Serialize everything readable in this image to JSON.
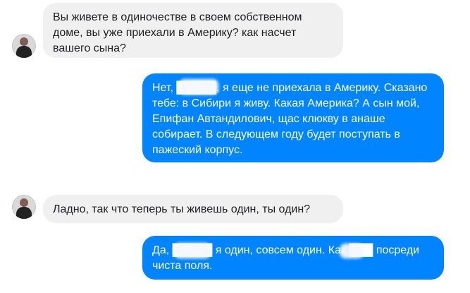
{
  "messages": [
    {
      "sender": "contact",
      "text": "Вы живете в одиночестве в своем собственном доме, вы уже приехали в Америку? как насчет вашего сына?"
    },
    {
      "sender": "me",
      "text": "Нет, █████, я еще не приехала в Америку. Сказано тебе: в Сибири я живу. Какая Америка? А сын мой, Епифан Автандилович, щас клюкву в анаше собирает. В следующем году будет поступать в пажеский корпус."
    },
    {
      "sender": "contact",
      "text": "Ладно, так что теперь ты живешь один, ты один?"
    },
    {
      "sender": "me",
      "text": "Да, █████ я один, совсем один. Как ███ посреди чиста поля."
    }
  ],
  "avatar": {
    "icon": "person-avatar-icon"
  },
  "colors": {
    "incoming": "#f1f0f0",
    "outgoing": "#0084ff",
    "text_incoming": "#1c1e21",
    "text_outgoing": "#ffffff"
  }
}
